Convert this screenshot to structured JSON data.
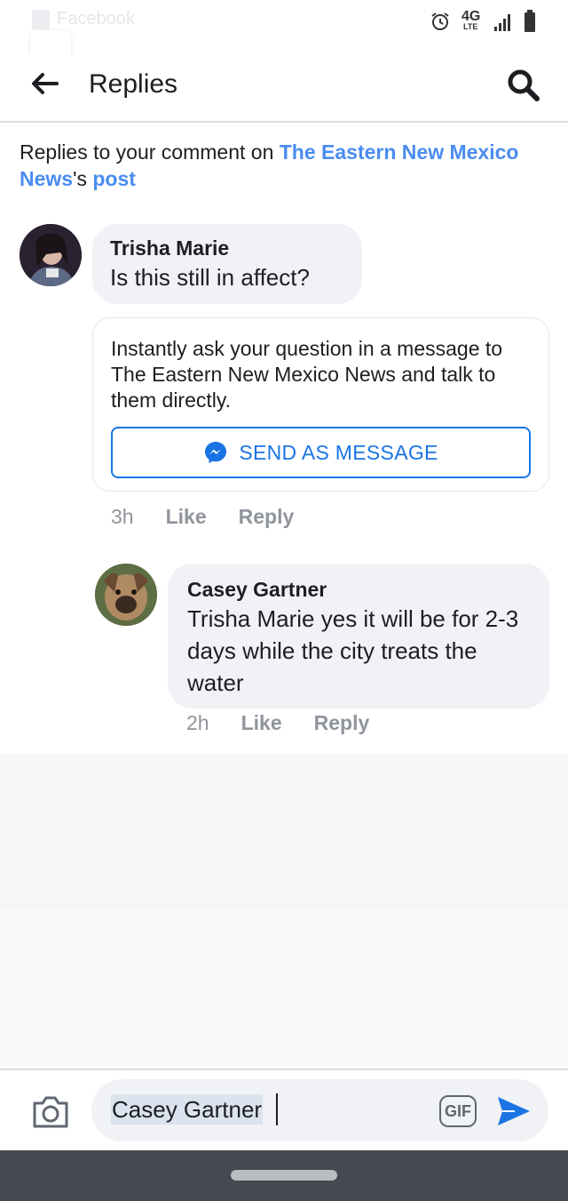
{
  "status_bar": {
    "ghost_app_label": "Facebook",
    "network_type": "4G",
    "network_sub": "LTE",
    "icons": [
      "alarm-icon",
      "signal-icon",
      "battery-icon"
    ]
  },
  "header": {
    "title": "Replies",
    "back_icon": "back-arrow-icon",
    "search_icon": "search-icon"
  },
  "context": {
    "prefix": "Replies to your comment on ",
    "page_name": "The Eastern New Mexico News",
    "possessive": "'s ",
    "post_link": "post"
  },
  "comments": [
    {
      "author": "Trisha Marie",
      "text": "Is this still in affect?",
      "time": "3h",
      "like": "Like",
      "reply": "Reply"
    },
    {
      "author": "Casey Gartner",
      "text": "Trisha Marie yes it will be for 2-3 days while the city treats the water",
      "time": "2h",
      "like": "Like",
      "reply": "Reply"
    }
  ],
  "message_prompt": {
    "text": "Instantly ask your question in a message to The Eastern New Mexico News and talk to them directly.",
    "button_label": "SEND AS MESSAGE",
    "button_icon": "messenger-icon"
  },
  "composer": {
    "value": "Casey Gartner",
    "gif_label": "GIF",
    "camera_icon": "camera-icon",
    "send_icon": "send-icon"
  },
  "colors": {
    "link_blue": "#4a8cf0",
    "brand_blue": "#1b74e4",
    "bubble_gray": "#f0f2f5",
    "meta_gray": "#90949c",
    "nav_bar": "#444a50"
  }
}
